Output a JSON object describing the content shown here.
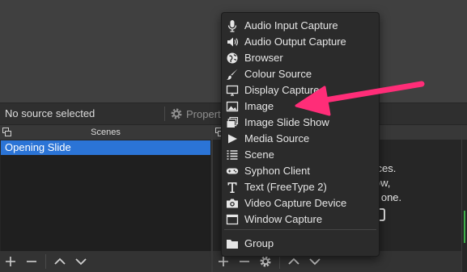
{
  "source_bar": {
    "no_source": "No source selected",
    "properties": "Propert"
  },
  "scenes": {
    "title": "Scenes",
    "items": [
      "Opening Slide"
    ]
  },
  "sources_partial": {
    "line1": "urces.",
    "line2": "low,",
    "line3": "d one."
  },
  "menu": {
    "items": [
      {
        "label": "Audio Input Capture",
        "icon": "microphone-icon"
      },
      {
        "label": "Audio Output Capture",
        "icon": "speaker-icon"
      },
      {
        "label": "Browser",
        "icon": "globe-icon"
      },
      {
        "label": "Colour Source",
        "icon": "paintbrush-icon"
      },
      {
        "label": "Display Capture",
        "icon": "monitor-icon"
      },
      {
        "label": "Image",
        "icon": "image-icon"
      },
      {
        "label": "Image Slide Show",
        "icon": "slideshow-icon"
      },
      {
        "label": "Media Source",
        "icon": "play-icon"
      },
      {
        "label": "Scene",
        "icon": "list-icon"
      },
      {
        "label": "Syphon Client",
        "icon": "gamepad-icon"
      },
      {
        "label": "Text (FreeType 2)",
        "icon": "text-icon"
      },
      {
        "label": "Video Capture Device",
        "icon": "camera-icon"
      },
      {
        "label": "Window Capture",
        "icon": "window-icon"
      }
    ],
    "group": {
      "label": "Group",
      "icon": "folder-icon"
    }
  },
  "colors": {
    "highlight": "#2b74d6",
    "arrow": "#ff2d78"
  }
}
